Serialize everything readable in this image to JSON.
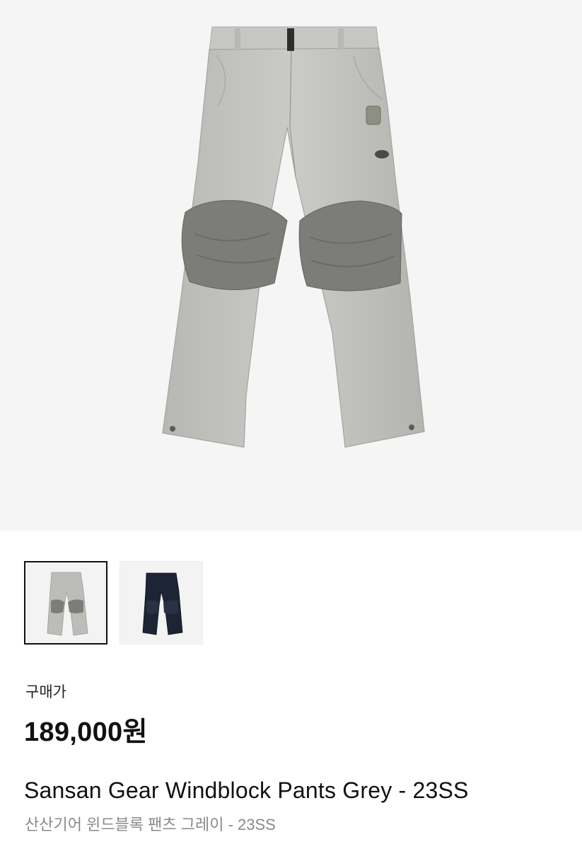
{
  "product": {
    "image_alt_icon": "pants-image",
    "thumbnails": [
      {
        "name": "thumbnail-grey",
        "color": "#bcbdb8",
        "selected": true
      },
      {
        "name": "thumbnail-navy",
        "color": "#1d2433",
        "selected": false
      }
    ],
    "price_label": "구매가",
    "price": "189,000원",
    "name_en": "Sansan Gear Windblock Pants Grey - 23SS",
    "name_ko": "산산기어 윈드블록 팬츠 그레이 - 23SS"
  },
  "colors": {
    "hero_bg": "#f5f5f5",
    "pants_grey": "#c4c5c1",
    "knee_patch": "#7c7d79",
    "navy": "#1d2433",
    "text_muted": "#8a8a8a"
  }
}
